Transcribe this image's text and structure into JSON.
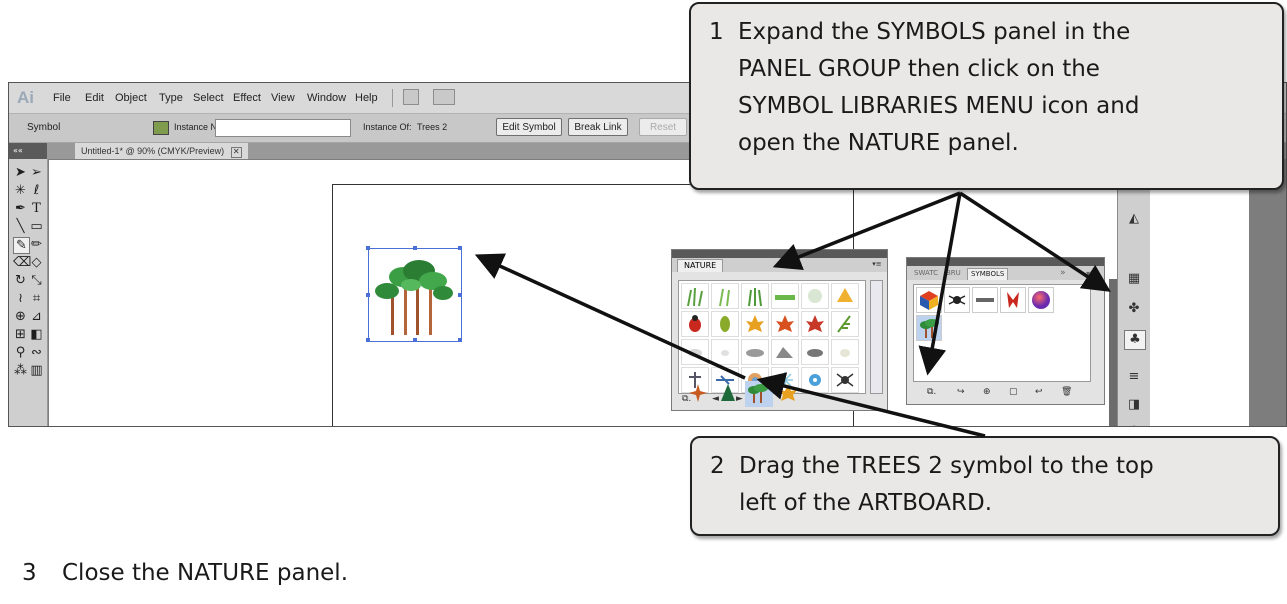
{
  "app": {
    "logo": "Ai",
    "menus": [
      "File",
      "Edit",
      "Object",
      "Type",
      "Select",
      "Effect",
      "View",
      "Window",
      "Help"
    ]
  },
  "control_bar": {
    "symbol_label": "Symbol",
    "instance_name_label": "Instance Name:",
    "instance_name_value": "",
    "instance_of_label": "Instance Of:",
    "instance_of_value": "Trees 2",
    "edit_symbol": "Edit Symbol",
    "break_link": "Break Link",
    "reset": "Reset"
  },
  "document": {
    "tab_title": "Untitled-1* @ 90% (CMYK/Preview)",
    "close_glyph": "✕"
  },
  "tools_panel": {
    "collapse": "««"
  },
  "nature_panel": {
    "tab": "NATURE",
    "menu_glyph": "▾≡",
    "footer": [
      "⧉.",
      "◄",
      "►"
    ]
  },
  "symbols_panel": {
    "tabs": [
      "SWATC",
      "BRU",
      "SYMBOLS"
    ],
    "more": "»",
    "footer": [
      "⧉.",
      "↪",
      "⊕",
      "▢",
      "↩",
      "🗑"
    ]
  },
  "callouts": {
    "step1_number": "1",
    "step1_lines": [
      "Expand the SYMBOLS panel in the",
      "PANEL GROUP then click on the",
      "SYMBOL LIBRARIES MENU icon and",
      "open the NATURE panel."
    ],
    "step2_number": "2",
    "step2_lines": [
      "Drag the TREES 2 symbol to the top",
      "left of the ARTBOARD."
    ]
  },
  "step3": {
    "number": "3",
    "text": "Close the NATURE panel."
  },
  "colors": {
    "callout_bg": "#eae7e7",
    "selection": "#4a6fd6",
    "panel_bg": "#e3e3e3"
  }
}
